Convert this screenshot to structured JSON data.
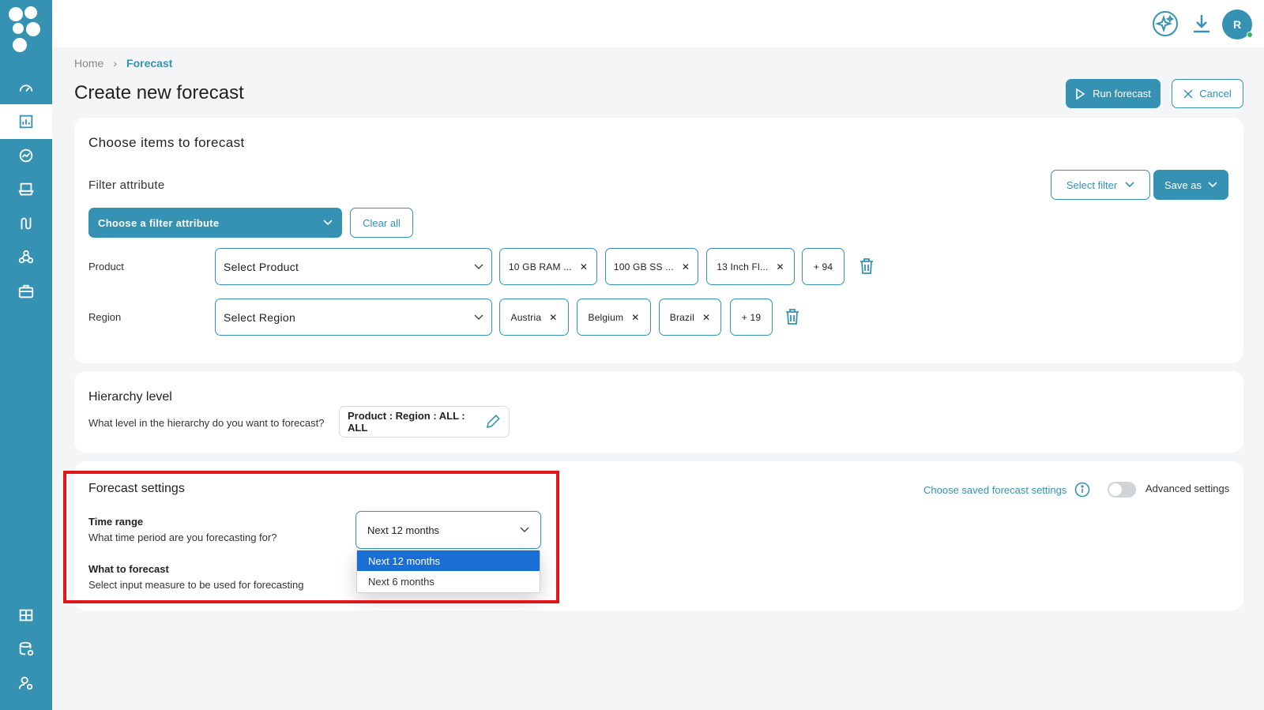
{
  "topbar": {
    "user_initial": "R"
  },
  "breadcrumb": {
    "home": "Home",
    "current": "Forecast"
  },
  "page": {
    "title": "Create new forecast",
    "run_label": "Run forecast",
    "cancel_label": "Cancel"
  },
  "items_card": {
    "title": "Choose items to forecast",
    "filter_attribute_label": "Filter attribute",
    "select_filter_label": "Select filter",
    "save_as_label": "Save as",
    "choose_attr_label": "Choose a filter attribute",
    "clear_all_label": "Clear all",
    "rows": [
      {
        "label": "Product",
        "placeholder": "Select Product",
        "chips": [
          "10 GB RAM ...",
          "100 GB SS ...",
          "13 Inch Fl..."
        ],
        "more": "+ 94"
      },
      {
        "label": "Region",
        "placeholder": "Select Region",
        "chips": [
          "Austria",
          "Belgium",
          "Brazil"
        ],
        "more": "+ 19"
      }
    ]
  },
  "hierarchy": {
    "title": "Hierarchy level",
    "question": "What level in the hierarchy do you want to forecast?",
    "value": "Product : Region : ALL : ALL"
  },
  "settings": {
    "title": "Forecast settings",
    "saved_link": "Choose saved forecast settings",
    "advanced_label": "Advanced settings",
    "advanced_on": false,
    "time_range_title": "Time range",
    "time_range_sub": "What time period are you forecasting for?",
    "time_range_value": "Next 12 months",
    "time_range_options": [
      "Next 12 months",
      "Next 6 months"
    ],
    "what_title": "What to forecast",
    "what_sub": "Select input measure to be used for forecasting"
  },
  "colors": {
    "accent": "#3592b3",
    "highlight": "#e0161b",
    "selected_option": "#1a6fd6"
  }
}
